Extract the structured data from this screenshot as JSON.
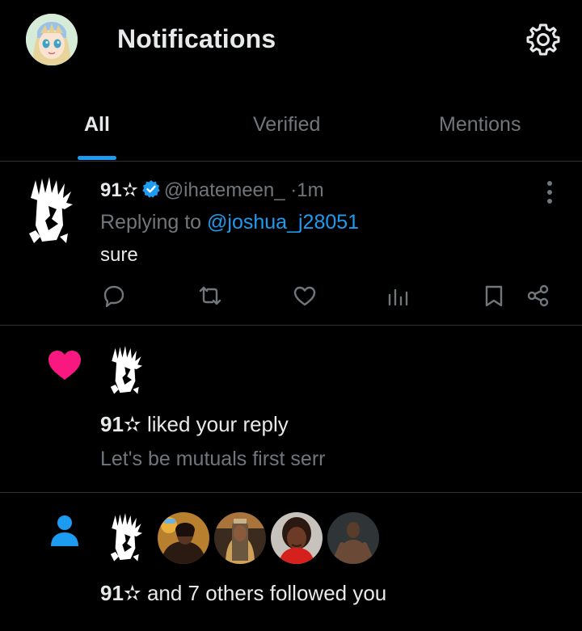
{
  "header": {
    "title": "Notifications",
    "avatar_icon": "anime-avatar-icon",
    "settings_icon": "gear-icon"
  },
  "tabs": [
    {
      "label": "All",
      "active": true
    },
    {
      "label": "Verified",
      "active": false
    },
    {
      "label": "Mentions",
      "active": false
    }
  ],
  "post": {
    "name": "91✫",
    "verified": true,
    "handle": "@ihatemeen_",
    "dot": "·",
    "time": "1m",
    "replying_prefix": "Replying to ",
    "replying_to": "@joshua_j28051",
    "text": "sure",
    "actions": [
      "reply-icon",
      "retweet-icon",
      "like-icon",
      "views-icon",
      "bookmark-icon",
      "share-icon"
    ]
  },
  "like_notification": {
    "actor": "91✫",
    "action": " liked your reply",
    "snippet": "Let's be mutuals first serr"
  },
  "follow_notification": {
    "actor": "91✫",
    "action": " and 7 others followed you"
  },
  "colors": {
    "background": "#000000",
    "accent": "#1d9bf0",
    "like": "#f91880",
    "muted_text": "#71767b",
    "primary_text": "#e7e9ea",
    "divider": "#2f3336"
  }
}
